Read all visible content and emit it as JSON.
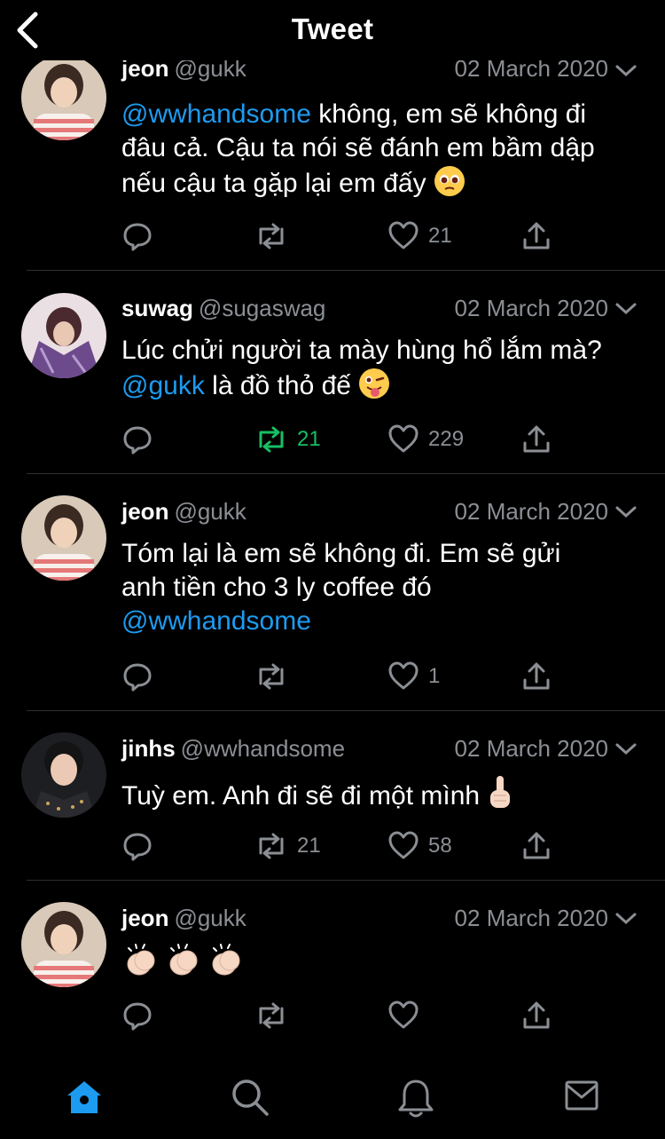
{
  "header": {
    "title": "Tweet",
    "back_icon": "chevron-left-icon"
  },
  "colors": {
    "mention": "#1d9bf0",
    "muted": "#8b8f94",
    "retweeted": "#17bf63",
    "active_tab": "#1d9bf0"
  },
  "tweets": [
    {
      "name": "jeon",
      "handle": "@gukk",
      "date": "02 March 2020",
      "body": [
        {
          "mention": "@wwhandsome",
          "text": " không, em sẽ không đi"
        },
        {
          "text": "đâu cả. Cậu ta nói sẽ đánh em bầm dập"
        },
        {
          "text": "nếu cậu ta gặp lại em đấy"
        }
      ],
      "emoji": "pleading-face-emoji",
      "likes": "21"
    },
    {
      "name": "suwag",
      "handle": "@sugaswag",
      "date": "02 March 2020",
      "body": [
        {
          "text": "Lúc chửi người ta mày hùng hổ lắm mà?"
        },
        {
          "mention": "@gukk",
          "text": " là đồ thỏ đế"
        }
      ],
      "emoji": "winking-tongue-face-emoji",
      "retweets": "21",
      "likes": "229"
    },
    {
      "name": "jeon",
      "handle": "@gukk",
      "date": "02 March 2020",
      "body": [
        {
          "text": "Tóm lại là em sẽ không đi. Em sẽ gửi"
        },
        {
          "text": "anh tiền cho 3 ly coffee đó"
        },
        {
          "mention": "@wwhandsome"
        }
      ],
      "likes": "1"
    },
    {
      "name": "jinhs",
      "handle": "@wwhandsome",
      "date": "02 March 2020",
      "body": [
        {
          "text": "Tuỳ em. Anh đi sẽ đi một mình"
        }
      ],
      "emoji": "raised-finger-emoji",
      "retweets": "21",
      "likes": "58"
    },
    {
      "name": "jeon",
      "handle": "@gukk",
      "date": "02 March 2020",
      "body": [
        {
          "text": ""
        }
      ],
      "emoji": "clapping-hands-emoji-x3"
    }
  ],
  "tabs": [
    "home-icon",
    "search-icon",
    "notifications-bell-icon",
    "messages-envelope-icon"
  ]
}
